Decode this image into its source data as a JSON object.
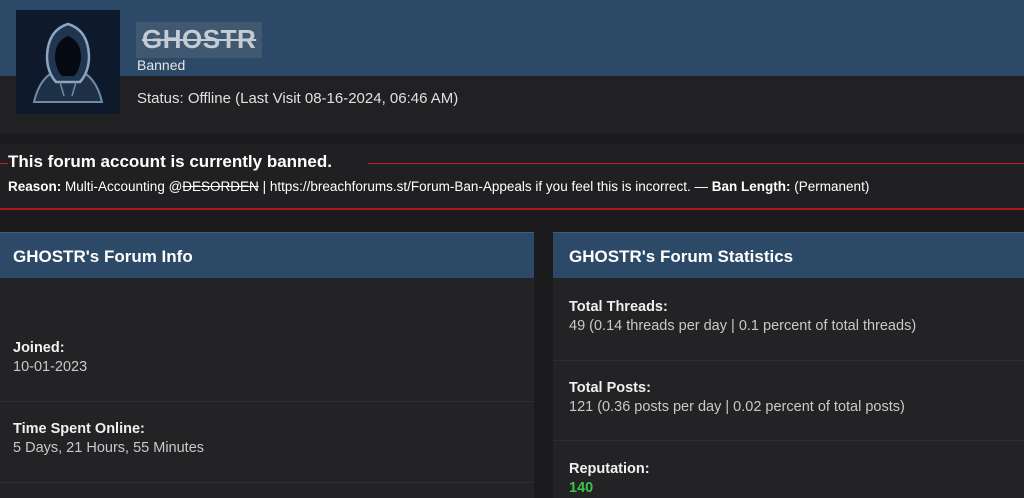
{
  "profile": {
    "username": "GHOSTR",
    "usergroup": "Banned",
    "status": "Status: Offline (Last Visit 08-16-2024, 06:46 AM)",
    "avatar_icon": "hooded-figure-icon"
  },
  "ban": {
    "title": "This forum account is currently banned.",
    "reason_label": "Reason:",
    "reason_text_1": "Multi-Accounting @",
    "reason_struck": "DESORDEN",
    "reason_text_2": "| https://breachforums.st/Forum-Ban-Appeals if you feel this is incorrect. —",
    "length_label": "Ban Length:",
    "length_value": "(Permanent)"
  },
  "forum_info": {
    "heading": "GHOSTR's Forum Info",
    "joined_label": "Joined:",
    "joined_value": "10-01-2023",
    "time_label": "Time Spent Online:",
    "time_value": "5 Days, 21 Hours, 55 Minutes"
  },
  "forum_stats": {
    "heading": "GHOSTR's Forum Statistics",
    "threads_label": "Total Threads:",
    "threads_value": "49 (0.14 threads per day | 0.1 percent of total threads)",
    "posts_label": "Total Posts:",
    "posts_value": "121 (0.36 posts per day | 0.02 percent of total posts)",
    "rep_label": "Reputation:",
    "rep_value": "140"
  },
  "colors": {
    "header_band": "#2c4a67",
    "ban_red": "#c41c22",
    "reputation_green": "#3ec24a"
  }
}
